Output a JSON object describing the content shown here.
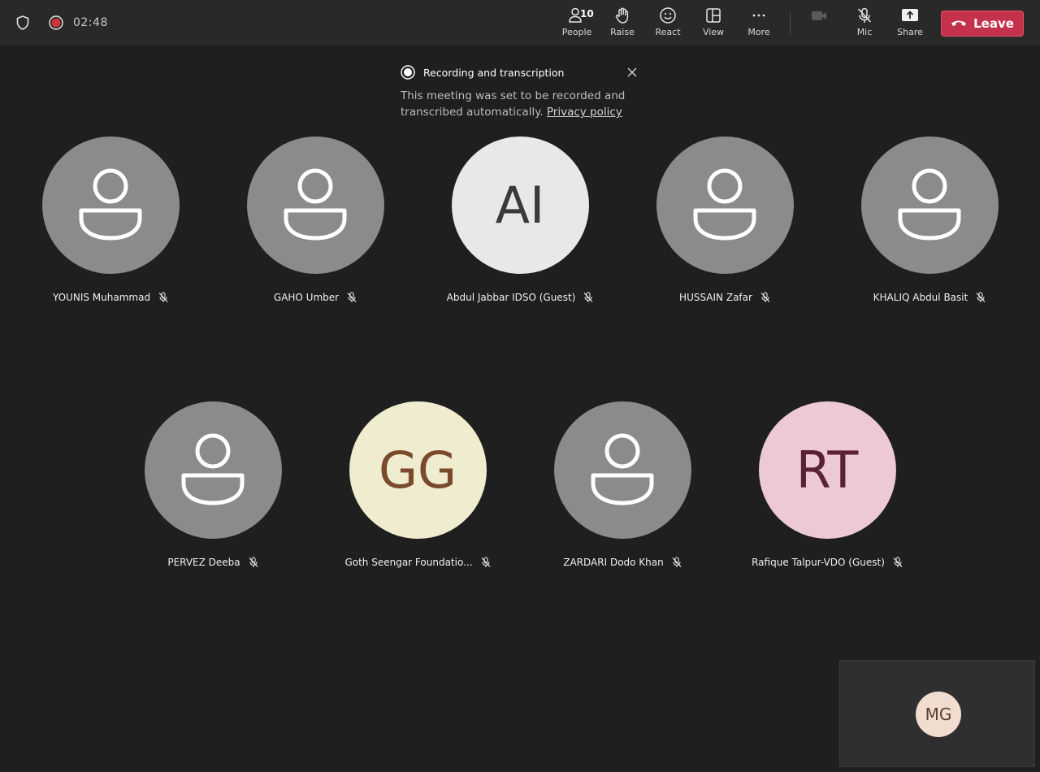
{
  "topbar": {
    "timer": "02:48",
    "people_count": "10",
    "tools": {
      "people": "People",
      "raise": "Raise",
      "react": "React",
      "view": "View",
      "more": "More",
      "mic": "Mic",
      "share": "Share"
    },
    "leave_label": "Leave",
    "leave_color": "#c4314b"
  },
  "notice": {
    "title": "Recording and transcription",
    "body": "This meeting was set to be recorded and transcribed automatically.",
    "link": "Privacy policy"
  },
  "participants": [
    {
      "name": "YOUNIS Muhammad",
      "initials": "",
      "avatar": "person-icon"
    },
    {
      "name": "GAHO Umber",
      "initials": "",
      "avatar": "person-icon"
    },
    {
      "name": "Abdul Jabbar IDSO (Guest)",
      "initials": "AI",
      "bg": "#e8e8e8",
      "fg": "#3a3a3a"
    },
    {
      "name": "HUSSAIN Zafar",
      "initials": "",
      "avatar": "person-icon"
    },
    {
      "name": "KHALIQ Abdul Basit",
      "initials": "",
      "avatar": "person-icon"
    },
    {
      "name": "PERVEZ Deeba",
      "initials": "",
      "avatar": "person-icon"
    },
    {
      "name": "Goth Seengar Foundatio...",
      "initials": "GG",
      "bg": "#efecd0",
      "fg": "#7b4a2c"
    },
    {
      "name": "ZARDARI Dodo Khan",
      "initials": "",
      "avatar": "person-icon"
    },
    {
      "name": "Rafique Talpur-VDO (Guest)",
      "initials": "RT",
      "bg": "#ecc9d3",
      "fg": "#5a2230"
    }
  ],
  "self": {
    "initials": "MG"
  }
}
